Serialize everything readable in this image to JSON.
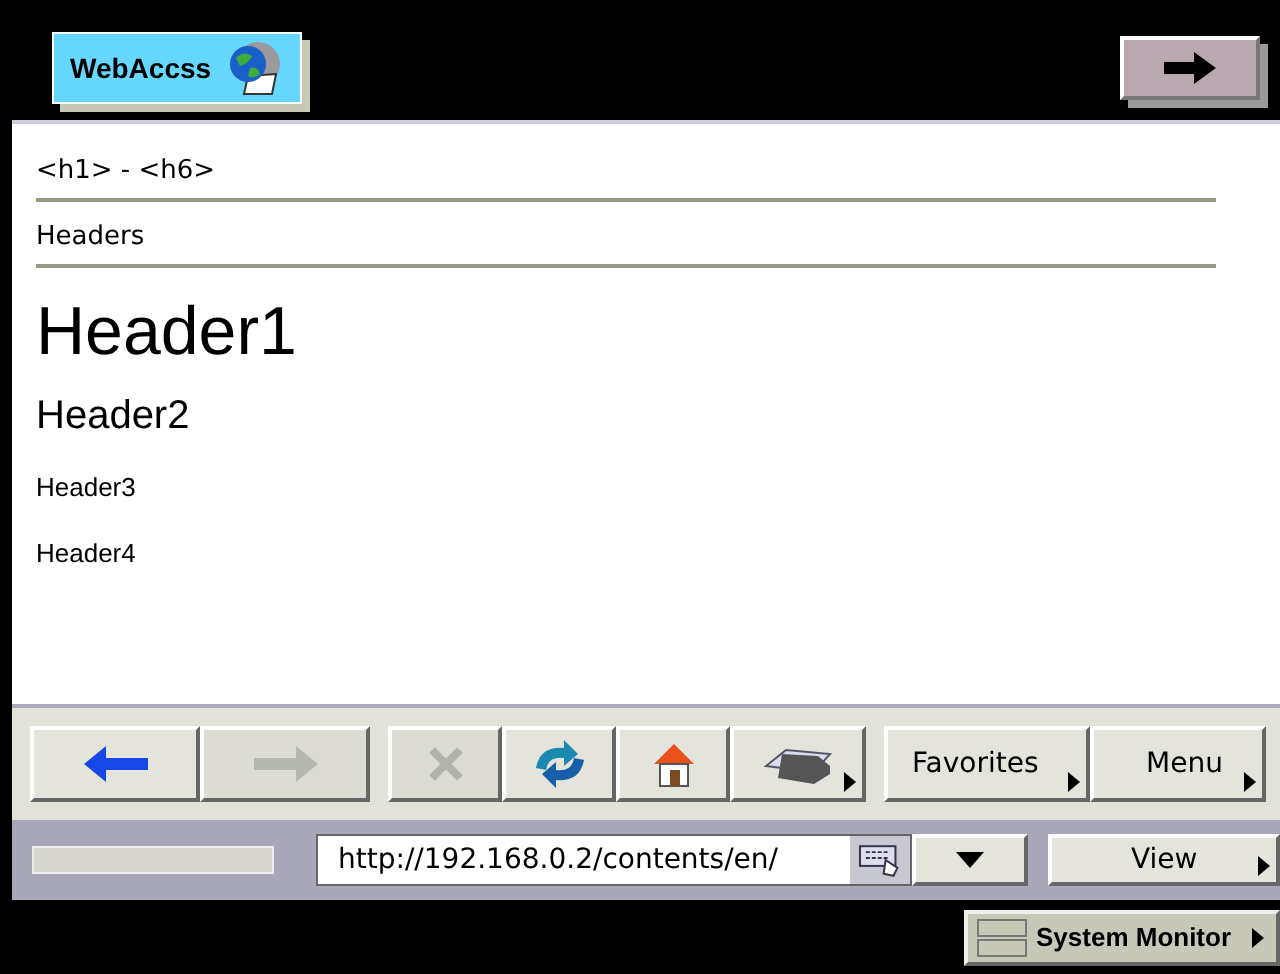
{
  "app_tab": {
    "label": "WebAccss"
  },
  "page": {
    "title": "<h1> - <h6>",
    "subtitle": "Headers",
    "headings": [
      {
        "kind": "h1",
        "text": "Header1"
      },
      {
        "kind": "h2",
        "text": "Header2"
      },
      {
        "kind": "h3",
        "text": "Header3"
      },
      {
        "kind": "h4",
        "text": "Header4"
      }
    ]
  },
  "toolbar": [
    {
      "kind": "back",
      "disabled": false,
      "menu": false
    },
    {
      "kind": "forward",
      "disabled": true,
      "menu": false
    },
    {
      "kind": "stop",
      "disabled": true,
      "menu": false
    },
    {
      "kind": "refresh",
      "disabled": false,
      "menu": false
    },
    {
      "kind": "home",
      "disabled": false,
      "menu": false
    },
    {
      "kind": "print",
      "disabled": false,
      "menu": true
    },
    {
      "kind": "text",
      "label": "Favorites",
      "disabled": false,
      "menu": true
    },
    {
      "kind": "text",
      "label": "Menu",
      "disabled": false,
      "menu": true
    }
  ],
  "address": {
    "value": "http://192.168.0.2/contents/en/"
  },
  "view_button": {
    "label": "View"
  },
  "system_monitor": {
    "label": "System Monitor"
  }
}
